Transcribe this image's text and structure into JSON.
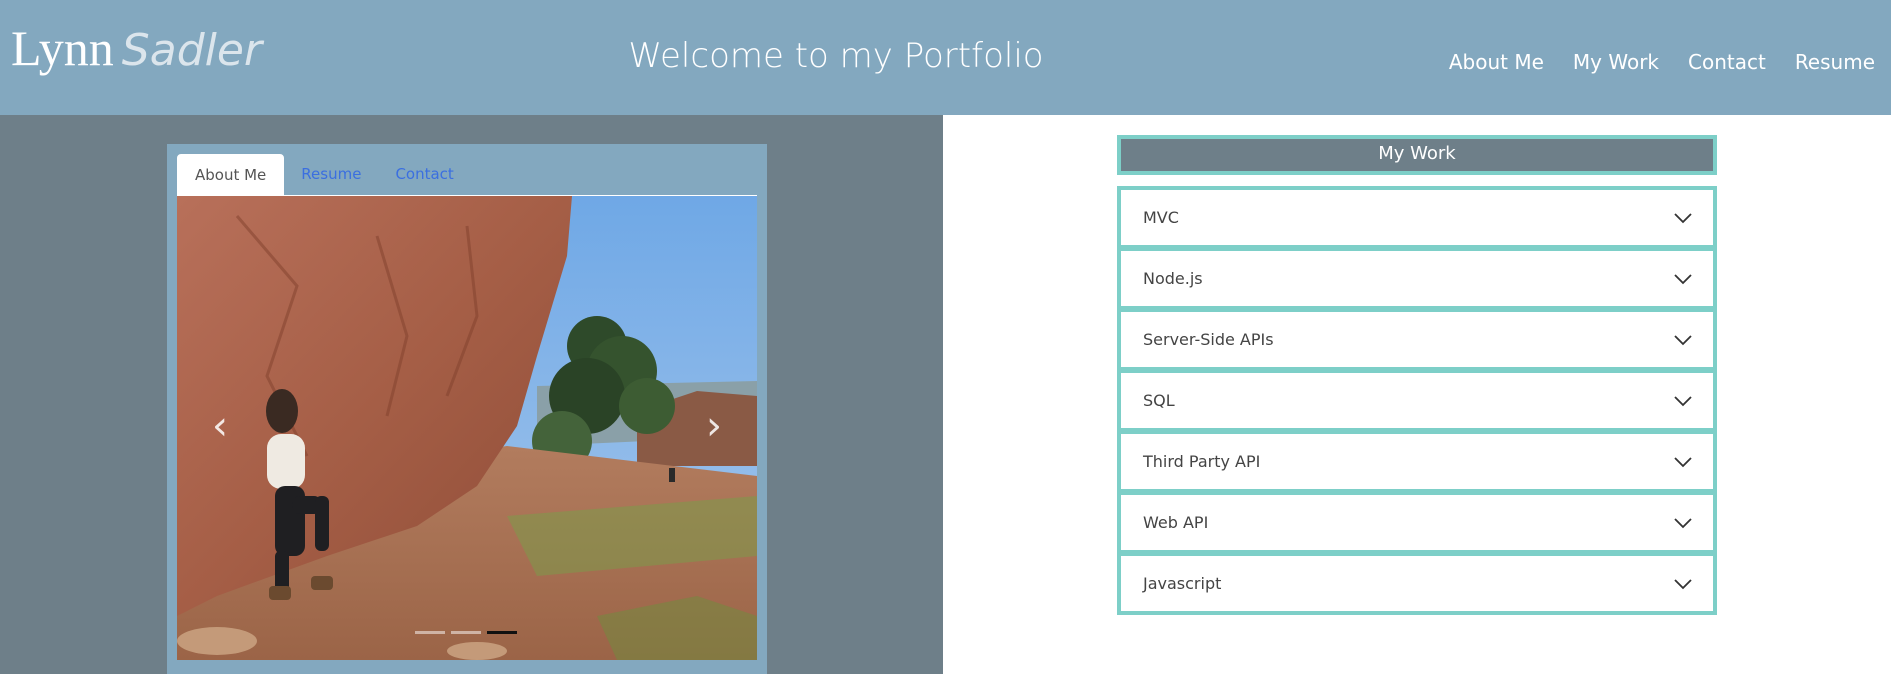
{
  "header": {
    "brand_first": "Lynn",
    "brand_last": "Sadler",
    "title": "Welcome to my Portfolio",
    "nav": [
      "About Me",
      "My Work",
      "Contact",
      "Resume"
    ]
  },
  "about_card": {
    "tabs": [
      "About Me",
      "Resume",
      "Contact"
    ],
    "active_tab": "About Me",
    "carousel": {
      "prev_icon": "chevron-left-icon",
      "next_icon": "chevron-right-icon",
      "slide_count": 3,
      "active_slide": 3
    }
  },
  "my_work": {
    "title": "My Work",
    "items": [
      "MVC",
      "Node.js",
      "Server-Side APIs",
      "SQL",
      "Third Party API",
      "Web API",
      "Javascript"
    ],
    "expand_icon": "chevron-down-icon"
  },
  "colors": {
    "header_bg": "#83a8bf",
    "left_bg": "#6e7f89",
    "accent_border": "#7dcfc8",
    "link": "#3b6fe0"
  }
}
